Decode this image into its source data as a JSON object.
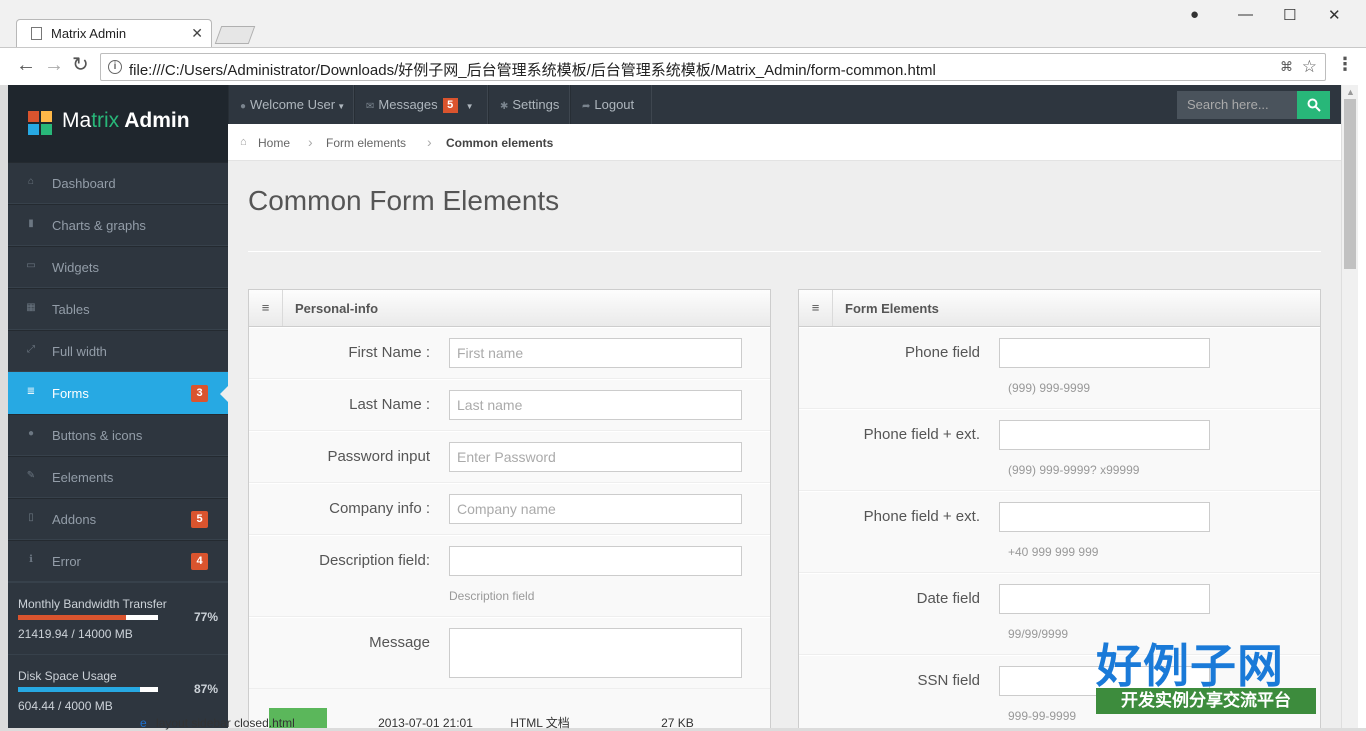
{
  "browser": {
    "tab_title": "Matrix Admin",
    "url": "file:///C:/Users/Administrator/Downloads/好例子网_后台管理系统模板/后台管理系统模板/Matrix_Admin/form-common.html"
  },
  "logo": {
    "part1": "Ma",
    "part2": "trix",
    "part3": " Admin"
  },
  "sidebar": {
    "items": [
      {
        "label": "Dashboard",
        "icon": "home-icon",
        "glyph": "⌂"
      },
      {
        "label": "Charts & graphs",
        "icon": "bar-chart-icon",
        "glyph": "▮"
      },
      {
        "label": "Widgets",
        "icon": "inbox-icon",
        "glyph": "▭"
      },
      {
        "label": "Tables",
        "icon": "table-icon",
        "glyph": "▦"
      },
      {
        "label": "Full width",
        "icon": "fullscreen-icon",
        "glyph": "⤢"
      },
      {
        "label": "Forms",
        "icon": "list-icon",
        "glyph": "≣",
        "badge": "3",
        "active": true
      },
      {
        "label": "Buttons & icons",
        "icon": "tint-icon",
        "glyph": "●"
      },
      {
        "label": "Eelements",
        "icon": "pencil-icon",
        "glyph": "✎"
      },
      {
        "label": "Addons",
        "icon": "file-icon",
        "glyph": "▯",
        "badge": "5"
      },
      {
        "label": "Error",
        "icon": "info-icon",
        "glyph": "ℹ",
        "badge": "4"
      }
    ],
    "stats": [
      {
        "title": "Monthly Bandwidth Transfer",
        "value": "21419.94 / 14000 MB",
        "percent_label": "77%",
        "fraction": 0.77,
        "color": "#da542e"
      },
      {
        "title": "Disk Space Usage",
        "value": "604.44 / 4000 MB",
        "percent_label": "87%",
        "fraction": 0.87,
        "color": "#27a9e3"
      }
    ]
  },
  "topbar": {
    "welcome": "Welcome User",
    "messages": "Messages",
    "messages_badge": "5",
    "settings": "Settings",
    "logout": "Logout",
    "search_placeholder": "Search here..."
  },
  "breadcrumb": {
    "home": "Home",
    "section": "Form elements",
    "current": "Common elements"
  },
  "page_title": "Common Form Elements",
  "personal_info": {
    "title": "Personal-info",
    "first_name_label": "First Name :",
    "first_name_placeholder": "First name",
    "last_name_label": "Last Name :",
    "last_name_placeholder": "Last name",
    "password_label": "Password input",
    "password_placeholder": "Enter Password",
    "company_label": "Company info :",
    "company_placeholder": "Company name",
    "description_label": "Description field:",
    "description_help": "Description field",
    "message_label": "Message"
  },
  "form_elements": {
    "title": "Form Elements",
    "phone_label": "Phone field",
    "phone_help": "(999) 999-9999",
    "phone_ext_label": "Phone field + ext.",
    "phone_ext_help": "(999) 999-9999? x99999",
    "phone_ext2_label": "Phone field + ext.",
    "phone_ext2_help": "+40 999 999 999",
    "date_label": "Date field",
    "date_help": "99/99/9999",
    "ssn_label": "SSN field",
    "ssn_help": "999-99-9999"
  },
  "filestrip": {
    "name": "layout sidebar closed.html",
    "date": "2013-07-01 21:01",
    "type": "HTML 文档",
    "size": "27 KB"
  },
  "watermark": {
    "main": "好例子网",
    "sub": "开发实例分享交流平台"
  },
  "colors": {
    "accent_blue": "#27a9e3",
    "badge_red": "#da542e",
    "search_green": "#28b779",
    "sidebar_dark": "#2e363f"
  }
}
